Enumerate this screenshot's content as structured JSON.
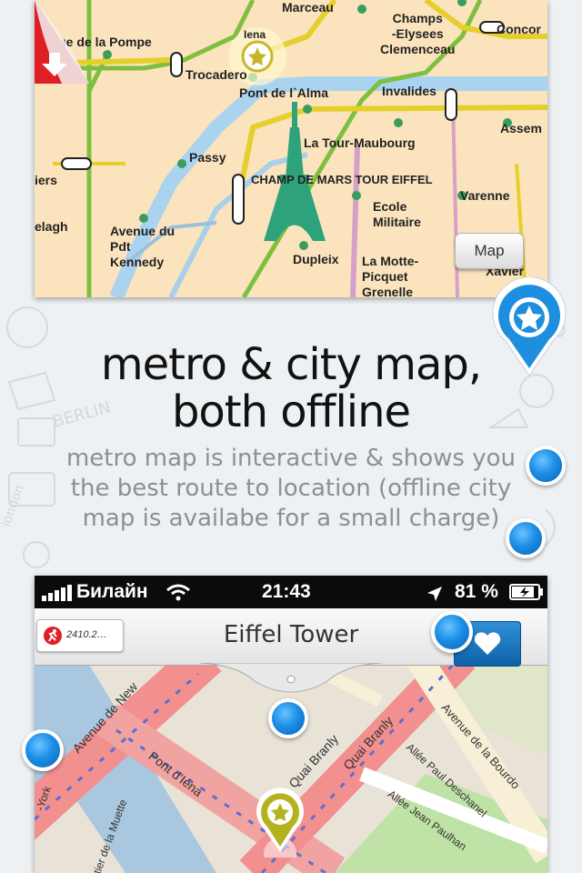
{
  "headline": {
    "line1": "metro & city map,",
    "line2": "both offline"
  },
  "subtitle": {
    "line1": "metro map is interactive & shows you",
    "line2": "the best route to location (offline city",
    "line3": "map is availabe for a small charge)"
  },
  "metro_map": {
    "stations": {
      "marceau": "Marceau",
      "champs": "Champs\n-Elysees\nClemenceau",
      "concorde": "Concor",
      "pompe": "Rue de la Pompe",
      "iena": "Iena",
      "trocadero": "Trocadero",
      "alma": "Pont de l`Alma",
      "invalides": "Invalides",
      "assemblee": "Assem",
      "maubourg": "La Tour-Maubourg",
      "passy": "Passy",
      "tour_eiffel": "CHAMP DE MARS TOUR EIFFEL",
      "varenne": "Varenne",
      "iers": "iers",
      "elagh": "elagh",
      "kennedy": "Avenue du\nPdt\nKennedy",
      "ecole": "Ecole\nMilitaire",
      "dupleix": "Dupleix",
      "picquet": "La Motte-\nPicquet\nGrenelle",
      "xavier": "Xavier"
    },
    "map_button": "Map",
    "colors": {
      "line_yellow": "#e5cf2c",
      "line_green": "#7fbf3f",
      "seine": "#a9d3ef",
      "eiffel": "#2ea37b"
    }
  },
  "phone": {
    "status": {
      "carrier": "Билайн",
      "time": "21:43",
      "battery": "81 %"
    },
    "nav": {
      "title": "Eiffel Tower",
      "ticket": "2410.2…"
    },
    "streets": {
      "new_york": "Avenue de New",
      "pont": "Pont d'Iéna",
      "branly1": "Quai Branly",
      "branly2": "Quai Branly",
      "bourdonnais": "Avenue de la Bourdo",
      "deschanel": "Allée Paul Deschanel",
      "paulhan": "Allée Jean Paulhan",
      "muette": "tier de la Muette",
      "york": "-York"
    },
    "icons": {
      "signal": "signal-bars-icon",
      "wifi": "wifi-icon",
      "location": "location-arrow-icon",
      "battery": "battery-icon"
    }
  }
}
